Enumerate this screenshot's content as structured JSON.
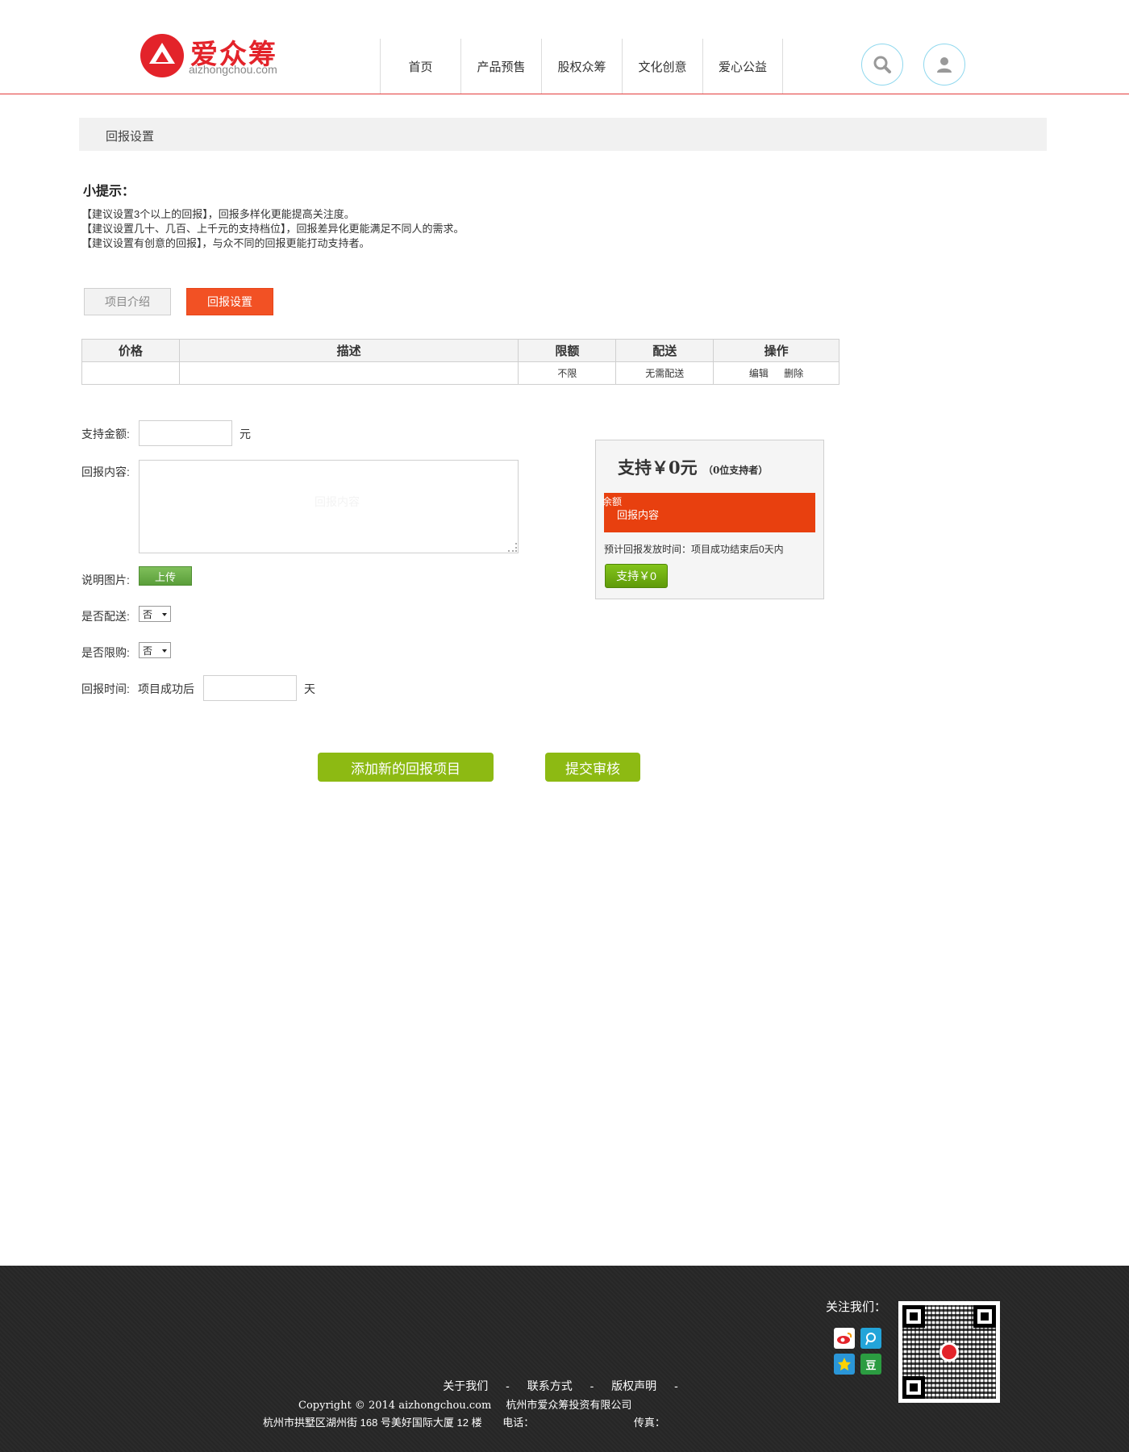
{
  "brand": {
    "name": "爱众筹",
    "domain": "aizhongchou.com"
  },
  "nav": {
    "items": [
      "首页",
      "产品预售",
      "股权众筹",
      "文化创意",
      "爱心公益"
    ]
  },
  "breadcrumb": "回报设置",
  "tips": {
    "title": "小提示：",
    "lines": [
      "【建议设置3个以上的回报】，回报多样化更能提高关注度。",
      "【建议设置几十、几百、上千元的支持档位】，回报差异化更能满足不同人的需求。",
      "【建议设置有创意的回报】，与众不同的回报更能打动支持者。"
    ]
  },
  "tabs": {
    "intro": "项目介绍",
    "reward": "回报设置"
  },
  "table": {
    "headers": [
      "价格",
      "描述",
      "限额",
      "配送",
      "操作"
    ],
    "rows": [
      {
        "price": "",
        "desc": "",
        "limit": "不限",
        "delivery": "无需配送",
        "edit": "编辑",
        "delete": "删除"
      }
    ]
  },
  "form": {
    "amount_label": "支持金额:",
    "amount_value": "",
    "amount_unit": "元",
    "content_label": "回报内容:",
    "content_placeholder": "回报内容",
    "image_label": "说明图片:",
    "upload_label": "上传",
    "delivery_label": "是否配送:",
    "delivery_value": "否",
    "limit_label": "是否限购:",
    "limit_value": "否",
    "time_label": "回报时间:",
    "time_prefix": "项目成功后",
    "time_value": "",
    "time_unit": "天"
  },
  "preview": {
    "title": "支持￥0元",
    "supporters": "（0位支持者）",
    "red_a": "余额",
    "red_b": "回报内容",
    "time_text": "预计回报发放时间：项目成功结束后0天内",
    "button": "支持￥0"
  },
  "actions": {
    "add": "添加新的回报项目",
    "submit": "提交审核"
  },
  "footer": {
    "follow": "关注我们：",
    "social": [
      "weibo-icon",
      "tencent-weibo-icon",
      "qzone-icon",
      "douban-icon"
    ],
    "douban_glyph": "豆",
    "links": [
      "关于我们",
      "联系方式",
      "版权声明"
    ],
    "link_separator": "-",
    "copyright": "Copyright © 2014  aizhongchou.com",
    "company": "杭州市爱众筹投资有限公司",
    "address": "杭州市拱墅区湖州街 168 号美好国际大厦 12 楼",
    "phone_label": "电话：",
    "fax_label": "传真："
  },
  "colors": {
    "brand_red": "#e3232a",
    "active_tab": "#f25124",
    "action_green": "#8dba13",
    "preview_red": "#e8400f"
  }
}
